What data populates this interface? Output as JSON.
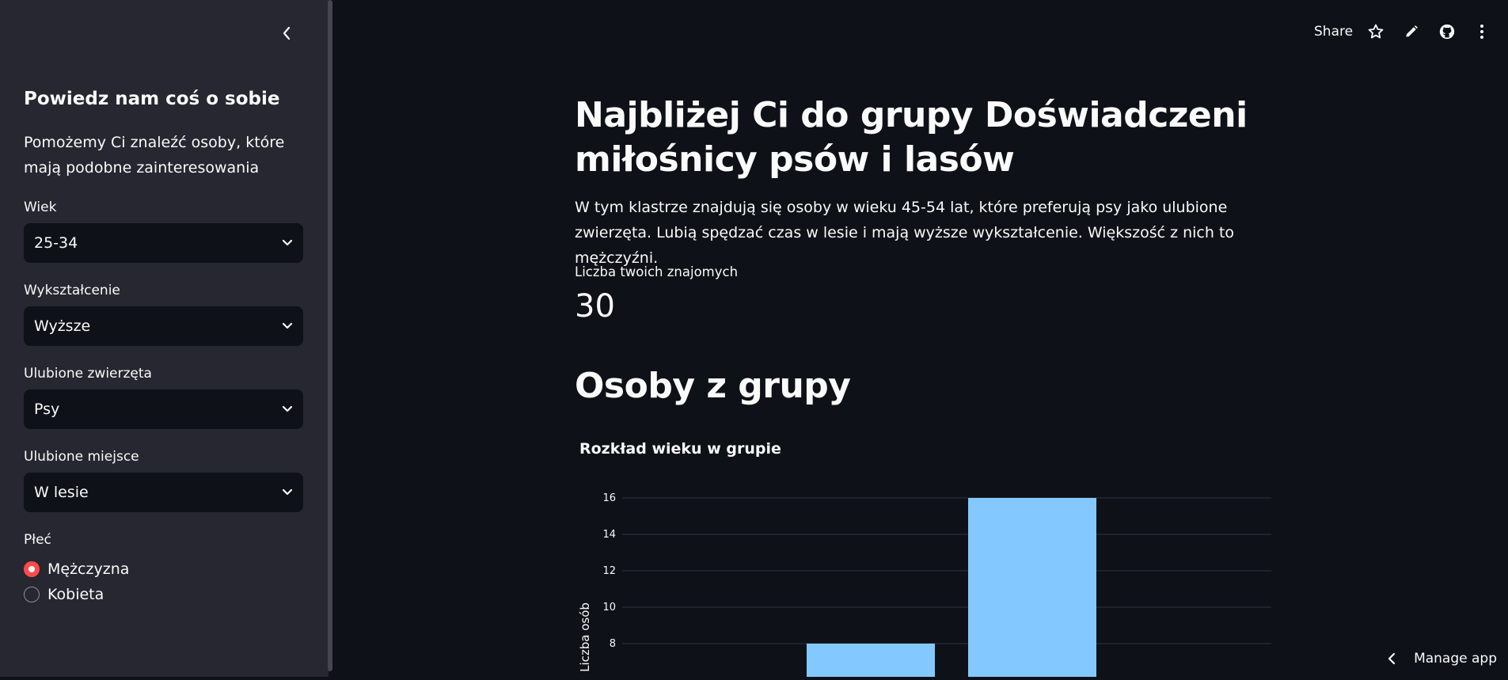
{
  "sidebar": {
    "title": "Powiedz nam coś o sobie",
    "description": "Pomożemy Ci znaleźć osoby, które mają podobne zainteresowania",
    "fields": [
      {
        "label": "Wiek",
        "value": "25-34"
      },
      {
        "label": "Wykształcenie",
        "value": "Wyższe"
      },
      {
        "label": "Ulubione zwierzęta",
        "value": "Psy"
      },
      {
        "label": "Ulubione miejsce",
        "value": "W lesie"
      }
    ],
    "gender": {
      "label": "Płeć",
      "options": [
        "Mężczyzna",
        "Kobieta"
      ],
      "selected": "Mężczyzna"
    }
  },
  "toolbar": {
    "share_label": "Share",
    "icons": [
      "star-icon",
      "pencil-icon",
      "github-icon",
      "more-vertical-icon"
    ]
  },
  "main": {
    "title": "Najbliżej Ci do grupy Doświadczeni miłośnicy psów i lasów",
    "description": "W tym klastrze znajdują się osoby w wieku 45-54 lat, które preferują psy jako ulubione zwierzęta. Lubią spędzać czas w lesie i mają wyższe wykształcenie. Większość z nich to mężczyźni.",
    "metric_label": "Liczba twoich znajomych",
    "metric_value": "30",
    "section_title": "Osoby z grupy"
  },
  "chart_data": {
    "type": "bar",
    "title": "Rozkład wieku w grupie",
    "ylabel": "Liczba osób",
    "xlabel": "",
    "yticks": [
      8,
      10,
      12,
      14,
      16
    ],
    "values": [
      8,
      16
    ],
    "bar_color": "#83c9ff",
    "grid": true
  },
  "footer": {
    "manage_label": "Manage app"
  },
  "colors": {
    "background": "#0e1117",
    "sidebar": "#262730",
    "accent": "#ff4b4b",
    "bar": "#83c9ff"
  }
}
